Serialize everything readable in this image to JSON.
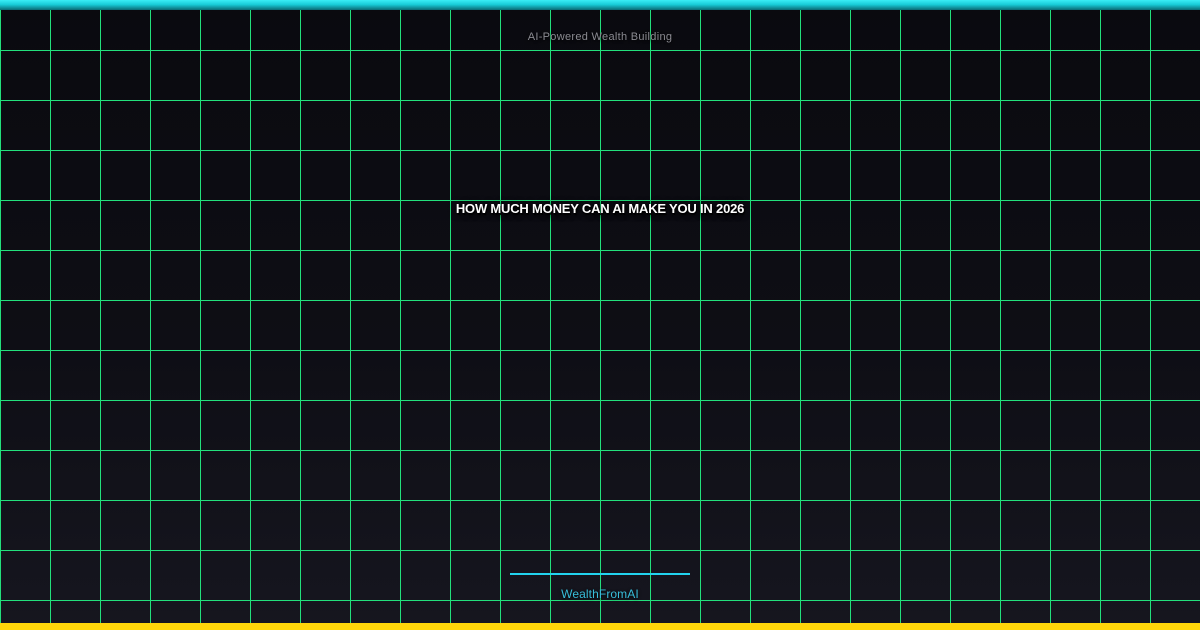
{
  "page": {
    "eyebrow": "AI-Powered Wealth Building",
    "title": "HOW MUCH MONEY CAN AI MAKE YOU IN 2026",
    "brand": "WealthFromAI"
  },
  "colors": {
    "accent_cyan": "#22d3ee",
    "accent_yellow": "#ffd60a",
    "grid_green": "#23e07c",
    "title_white": "#ffffff",
    "eyebrow_gray": "#8b8b92",
    "brand_cyan": "#38bdda",
    "background_top": "#0a0a0f",
    "background_bottom": "#16161f"
  }
}
